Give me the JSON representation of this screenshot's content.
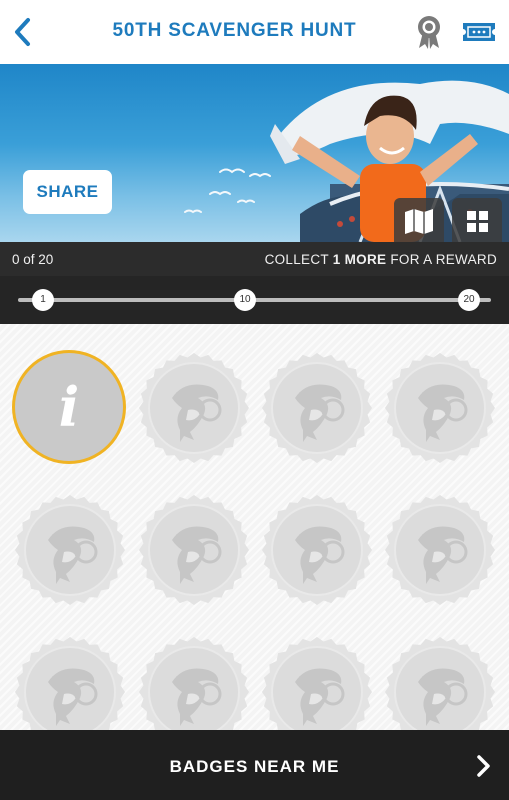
{
  "header": {
    "title": "50TH SCAVENGER HUNT",
    "back_icon": "chevron-left-icon",
    "badge_icon": "award-ribbon-icon",
    "ticket_icon": "ticket-icon",
    "accent_color": "#1e7bbd"
  },
  "hero": {
    "share_label": "SHARE",
    "map_icon": "map-icon",
    "grid_icon": "grid-view-icon"
  },
  "progress": {
    "count_text": "0 of 20",
    "collect_prefix": "COLLECT ",
    "collect_bold": "1 MORE",
    "collect_suffix": " FOR A REWARD",
    "collected": 0,
    "total": 20,
    "milestones": [
      "1",
      "10",
      "20"
    ]
  },
  "badges": {
    "info_symbol": "i",
    "info_border_color": "#f0b323",
    "locked_icon": "orca-seal-icon",
    "visible_locked_count": 11
  },
  "footer": {
    "label": "BADGES NEAR ME",
    "chevron_icon": "chevron-right-icon"
  }
}
